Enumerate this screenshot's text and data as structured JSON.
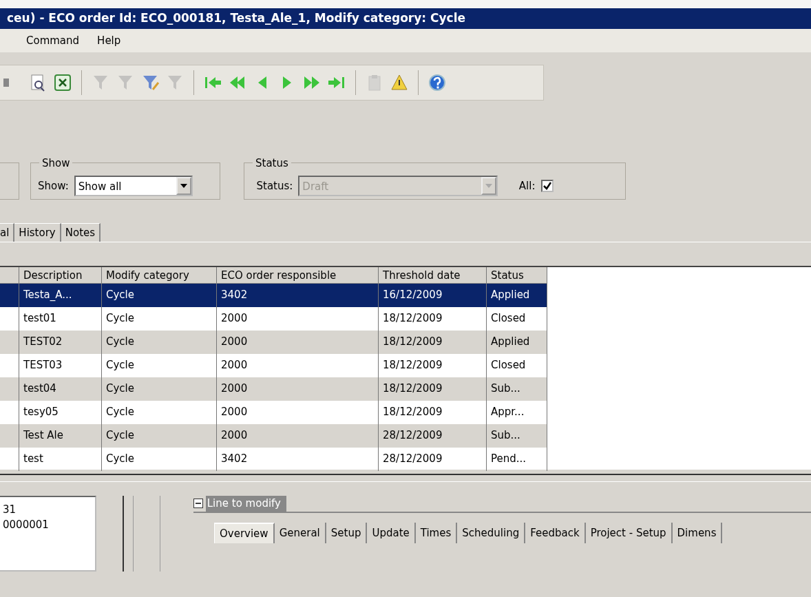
{
  "window": {
    "title": "ceu) - ECO order Id: ECO_000181, Testa_Ale_1, Modify category: Cycle"
  },
  "menu": [
    "Command",
    "Help"
  ],
  "toolbar": [
    {
      "kind": "partial",
      "disabled": false
    },
    {
      "kind": "preview",
      "disabled": false
    },
    {
      "kind": "excel",
      "disabled": false
    },
    {
      "kind": "sep"
    },
    {
      "kind": "filter",
      "disabled": true
    },
    {
      "kind": "filter",
      "disabled": true
    },
    {
      "kind": "filter-edit",
      "disabled": false
    },
    {
      "kind": "filter",
      "disabled": true
    },
    {
      "kind": "sep"
    },
    {
      "kind": "first",
      "disabled": false
    },
    {
      "kind": "prev-page",
      "disabled": false
    },
    {
      "kind": "prev",
      "disabled": false
    },
    {
      "kind": "next",
      "disabled": false
    },
    {
      "kind": "next-page",
      "disabled": false
    },
    {
      "kind": "last",
      "disabled": false
    },
    {
      "kind": "sep"
    },
    {
      "kind": "clipboard",
      "disabled": true
    },
    {
      "kind": "alert",
      "disabled": false
    },
    {
      "kind": "sep"
    },
    {
      "kind": "help",
      "disabled": false
    }
  ],
  "show_group": {
    "legend": "Show",
    "label": "Show:",
    "value": "Show all"
  },
  "status_group": {
    "legend": "Status",
    "label": "Status:",
    "value": "Draft",
    "disabled": true,
    "all_label": "All:",
    "all_checked": true
  },
  "tabs": [
    {
      "label": "al",
      "selected": false
    },
    {
      "label": "History",
      "selected": false
    },
    {
      "label": "Notes",
      "selected": false
    }
  ],
  "table": {
    "columns": [
      "",
      "Description",
      "Modify category",
      "ECO order responsible",
      "Threshold date",
      "Status"
    ],
    "rows": [
      {
        "selected": true,
        "cells": [
          "",
          "Testa_A...",
          "Cycle",
          "3402",
          "16/12/2009",
          "Applied"
        ]
      },
      {
        "selected": false,
        "cells": [
          "",
          "test01",
          "Cycle",
          "2000",
          "18/12/2009",
          "Closed"
        ]
      },
      {
        "selected": false,
        "cells": [
          "",
          "TEST02",
          "Cycle",
          "2000",
          "18/12/2009",
          "Applied"
        ]
      },
      {
        "selected": false,
        "cells": [
          "",
          "TEST03",
          "Cycle",
          "2000",
          "18/12/2009",
          "Closed"
        ]
      },
      {
        "selected": false,
        "cells": [
          "",
          "test04",
          "Cycle",
          "2000",
          "18/12/2009",
          "Sub..."
        ]
      },
      {
        "selected": false,
        "cells": [
          "",
          "tesy05",
          "Cycle",
          "2000",
          "18/12/2009",
          "Appr..."
        ]
      },
      {
        "selected": false,
        "cells": [
          "",
          "Test Ale",
          "Cycle",
          "2000",
          "28/12/2009",
          "Sub..."
        ]
      },
      {
        "selected": false,
        "cells": [
          "",
          "test",
          "Cycle",
          "3402",
          "28/12/2009",
          "Pend..."
        ]
      }
    ]
  },
  "detail": {
    "lines": [
      "31",
      "0000001"
    ],
    "group_title": "Line to modify",
    "expanded": true,
    "tabs": [
      {
        "label": "Overview",
        "selected": true
      },
      {
        "label": "General",
        "selected": false
      },
      {
        "label": "Setup",
        "selected": false
      },
      {
        "label": "Update",
        "selected": false
      },
      {
        "label": "Times",
        "selected": false
      },
      {
        "label": "Scheduling",
        "selected": false
      },
      {
        "label": "Feedback",
        "selected": false
      },
      {
        "label": "Project - Setup",
        "selected": false
      },
      {
        "label": "Dimens",
        "selected": false
      }
    ]
  }
}
